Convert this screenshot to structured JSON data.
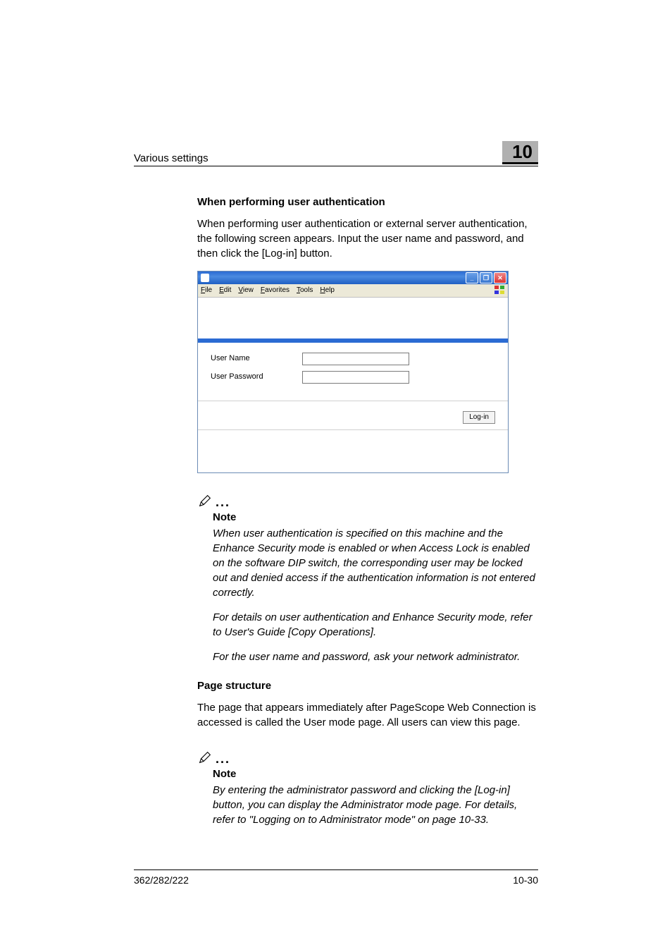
{
  "header": {
    "section_title": "Various settings",
    "chapter_number": "10"
  },
  "auth": {
    "heading": "When performing user authentication",
    "intro": "When performing user authentication or external server authentication, the following screen appears. Input the user name and password, and then click the [Log-in] button."
  },
  "window": {
    "menus": [
      "File",
      "Edit",
      "View",
      "Favorites",
      "Tools",
      "Help"
    ],
    "user_name_label": "User Name",
    "user_password_label": "User Password",
    "login_button": "Log-in"
  },
  "note1": {
    "label": "Note",
    "p1": "When user authentication is specified on this machine and the Enhance Security mode is enabled or when Access Lock is enabled on the software DIP switch, the corresponding user may be locked out and denied access if the authentication information is not entered correctly.",
    "p2": "For details on user authentication and Enhance Security mode, refer to User's Guide [Copy Operations].",
    "p3": "For the user name and password, ask your network administrator."
  },
  "page_structure": {
    "heading": "Page structure",
    "body": "The page that appears immediately after PageScope Web Connection is accessed is called the User mode page. All users can view this page."
  },
  "note2": {
    "label": "Note",
    "p1": "By entering the administrator password and clicking the [Log-in] button, you can display the Administrator mode page. For details, refer to \"Logging on to Administrator mode\" on page 10-33."
  },
  "footer": {
    "model": "362/282/222",
    "page": "10-30"
  }
}
